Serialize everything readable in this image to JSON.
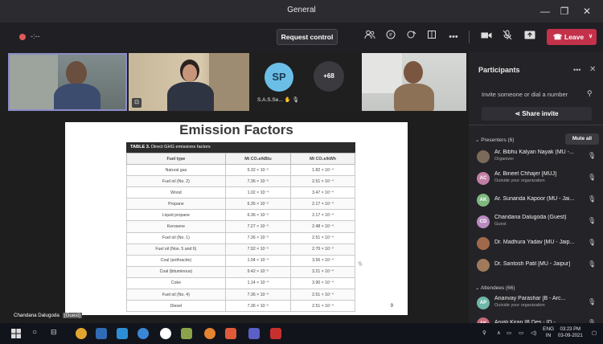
{
  "window": {
    "title": "General"
  },
  "toolbar": {
    "timer": "-:--",
    "request_control_label": "Request control",
    "leave_label": "Leave"
  },
  "video": {
    "sp_initials": "SP",
    "sp_name": "S.A.S.Se...",
    "overflow_count": "+68"
  },
  "slide": {
    "title": "Emission Factors",
    "caption_prefix": "TABLE 3.",
    "caption_text": "Direct GHG emissions factors",
    "columns": [
      "Fuel type",
      "Mt CO₂e/kBtu",
      "Mt CO₂e/kWh"
    ],
    "rows": [
      [
        "Natural gas",
        "5.32 × 10⁻⁵",
        "1.82 × 10⁻⁴"
      ],
      [
        "Fuel oil (No. 2)",
        "7.36 × 10⁻⁵",
        "2.51 × 10⁻⁴"
      ],
      [
        "Wood",
        "1.02 × 10⁻⁴",
        "3.47 × 10⁻⁴"
      ],
      [
        "Propane",
        "6.35 × 10⁻⁵",
        "2.17 × 10⁻⁴"
      ],
      [
        "Liquid propane",
        "6.36 × 10⁻⁵",
        "2.17 × 10⁻⁴"
      ],
      [
        "Kerosene",
        "7.27 × 10⁻⁵",
        "2.48 × 10⁻⁴"
      ],
      [
        "Fuel oil (No. 1)",
        "7.36 × 10⁻⁵",
        "2.51 × 10⁻⁴"
      ],
      [
        "Fuel oil (Nos. 5 and 6)",
        "7.92 × 10⁻⁵",
        "2.70 × 10⁻⁴"
      ],
      [
        "Coal (anthracite)",
        "1.04 × 10⁻⁴",
        "3.56 × 10⁻⁴"
      ],
      [
        "Coal (bituminous)",
        "9.42 × 10⁻⁵",
        "3.21 × 10⁻⁴"
      ],
      [
        "Coke",
        "1.14 × 10⁻⁴",
        "3.90 × 10⁻⁴"
      ],
      [
        "Fuel oil (No. 4)",
        "7.36 × 10⁻⁵",
        "2.51 × 10⁻⁴"
      ],
      [
        "Diesel",
        "7.36 × 10⁻⁵",
        "2.51 × 10⁻⁴"
      ]
    ],
    "page_number": "9",
    "presenter_name": "Chandana Dalugoda",
    "presenter_tag": "(Guest)"
  },
  "panel": {
    "title": "Participants",
    "invite_placeholder": "Invite someone or dial a number",
    "share_invite_label": "Share invite",
    "presenters_header": "Presenters (6)",
    "mute_all_label": "Mute all",
    "attendees_header": "Attendees (66)",
    "presenters": [
      {
        "name": "Ar. Bibhu Kalyan Nayak (MU -...",
        "role": "Organizer",
        "initials": "",
        "color": "#7b6a5a"
      },
      {
        "name": "Ar. Bineet Chhajer [MUJ]",
        "role": "Outside your organization",
        "initials": "AC",
        "color": "#c17fa6"
      },
      {
        "name": "Ar. Sunanda Kapoor (MU - Jai...",
        "role": "",
        "initials": "AK",
        "color": "#7fb87f"
      },
      {
        "name": "Chandana Dalugoda (Guest)",
        "role": "Guest",
        "initials": "CD",
        "color": "#b98ac0"
      },
      {
        "name": "Dr. Madhura Yadav [MU - Jaip...",
        "role": "",
        "initials": "",
        "color": "#a06a4a"
      },
      {
        "name": "Dr. Santosh Patil [MU - Jaipur]",
        "role": "",
        "initials": "",
        "color": "#a07a5a"
      }
    ],
    "attendees": [
      {
        "name": "Ananvay Parashar [B - Arc...",
        "role": "Outside your organization",
        "initials": "AP",
        "color": "#6fb7a8"
      },
      {
        "name": "Anjali Kiran [B.Des - ID -...",
        "role": "",
        "initials": "AK",
        "color": "#c56a7a"
      }
    ]
  },
  "taskbar": {
    "lang_top": "ENG",
    "lang_bottom": "IN",
    "time": "03:23 PM",
    "date": "03-09-2021"
  }
}
